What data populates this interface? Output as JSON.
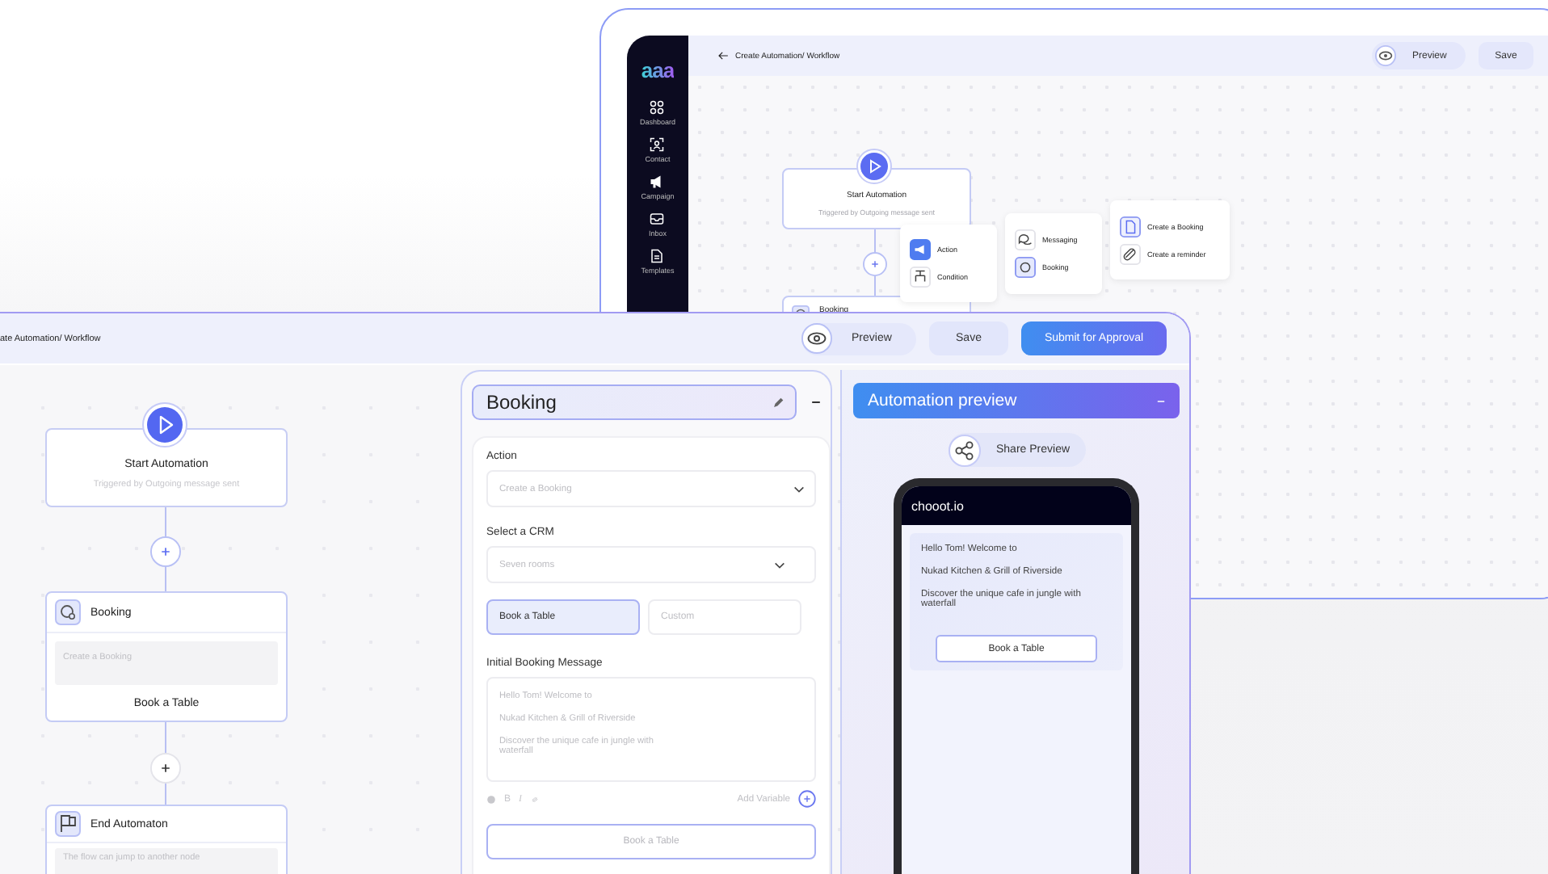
{
  "back_window": {
    "logo": "aaa",
    "breadcrumb": "Create Automation/ Workflow",
    "preview_button": "Preview",
    "save_button": "Save",
    "sidebar": {
      "items": [
        {
          "label": "Dashboard"
        },
        {
          "label": "Contact"
        },
        {
          "label": "Campaign"
        },
        {
          "label": "Inbox"
        },
        {
          "label": "Templates"
        }
      ]
    },
    "flow": {
      "start": {
        "title": "Start Automation",
        "subtitle": "Triggered by Outgoing message sent"
      },
      "next_node": {
        "title": "Booking"
      }
    },
    "step_menu": {
      "items": [
        {
          "label": "Action",
          "selected": true
        },
        {
          "label": "Condition",
          "selected": false
        }
      ]
    },
    "action_menu": {
      "items": [
        {
          "label": "Messaging",
          "selected": false
        },
        {
          "label": "Booking",
          "selected": true
        }
      ]
    },
    "booking_menu": {
      "items": [
        {
          "label": "Create a Booking",
          "selected": true
        },
        {
          "label": "Create a reminder",
          "selected": false
        }
      ]
    }
  },
  "front_window": {
    "breadcrumb": "ate Automation/ Workflow",
    "preview_button": "Preview",
    "save_button": "Save",
    "submit_button": "Submit for Approval",
    "flow": {
      "start": {
        "title": "Start Automation",
        "subtitle": "Triggered by Outgoing message sent"
      },
      "booking": {
        "title": "Booking",
        "placeholder": "Create a Booking",
        "button": "Book a Table"
      },
      "end": {
        "title": "End Automaton",
        "placeholder": "The flow can jump to another node"
      }
    },
    "editor": {
      "title": "Booking",
      "action": {
        "label": "Action",
        "placeholder": "Create a Booking"
      },
      "crm": {
        "label": "Select a CRM",
        "placeholder": "Seven rooms"
      },
      "options": [
        {
          "label": "Book a Table",
          "selected": true
        },
        {
          "label": "Custom",
          "selected": false
        }
      ],
      "message": {
        "label": "Initial Booking Message",
        "lines": [
          "Hello Tom! Welcome to",
          "Nukad Kitchen & Grill of Riverside",
          "Discover the unique cafe in jungle with waterfall"
        ]
      },
      "toolbar": [
        "B",
        "I"
      ],
      "add_variable": "Add Variable",
      "button": "Book a Table"
    },
    "preview": {
      "title": "Automation preview",
      "share_button": "Share Preview",
      "brand": "chooot.io",
      "messages": [
        "Hello Tom! Welcome to",
        "Nukad Kitchen & Grill of Riverside",
        "Discover the unique cafe in jungle with waterfall"
      ],
      "button": "Book a Table"
    }
  }
}
